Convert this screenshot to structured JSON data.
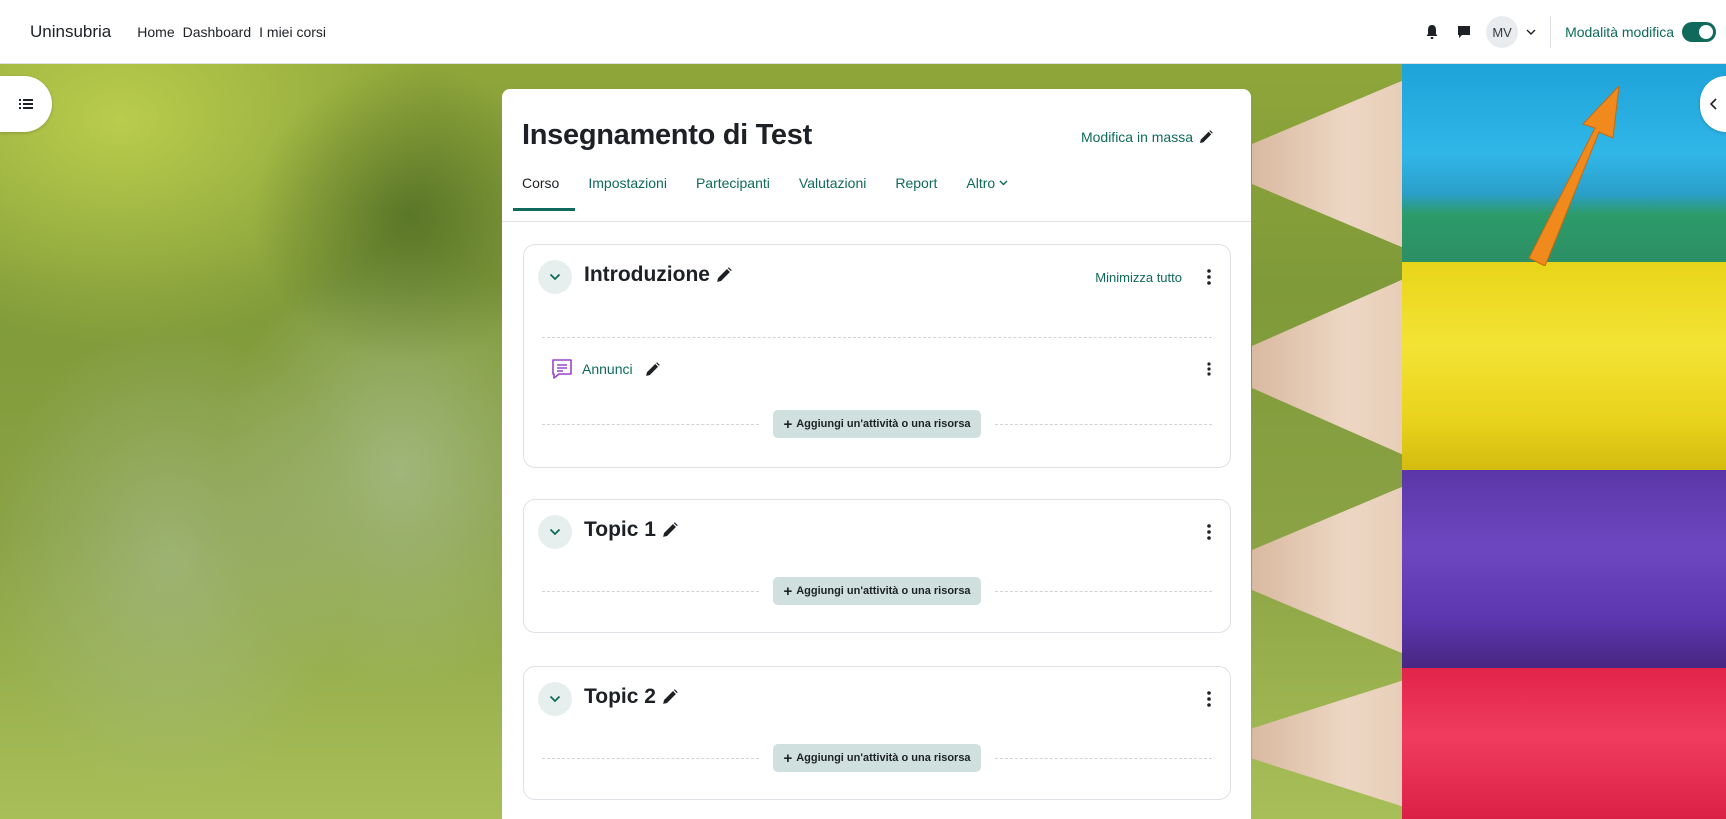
{
  "navbar": {
    "brand": "Uninsubria",
    "links": [
      "Home",
      "Dashboard",
      "I miei corsi"
    ],
    "avatar_initials": "MV",
    "edit_mode_label": "Modalità modifica",
    "edit_mode_on": true,
    "icons": [
      "bell-icon",
      "chat-icon",
      "chevron-down-icon"
    ]
  },
  "course": {
    "title": "Insegnamento di Test",
    "bulk_edit_label": "Modifica in massa",
    "tabs": [
      {
        "label": "Corso",
        "active": true
      },
      {
        "label": "Impostazioni",
        "active": false
      },
      {
        "label": "Partecipanti",
        "active": false
      },
      {
        "label": "Valutazioni",
        "active": false
      },
      {
        "label": "Report",
        "active": false
      },
      {
        "label": "Altro",
        "active": false
      }
    ]
  },
  "sections": [
    {
      "title": "Introduzione",
      "collapse_all_label": "Minimizza tutto",
      "activities": [
        {
          "name": "Annunci",
          "icon": "forum-icon"
        }
      ],
      "add_label": "Aggiungi un'attività o una risorsa"
    },
    {
      "title": "Topic 1",
      "activities": [],
      "add_label": "Aggiungi un'attività o una risorsa"
    },
    {
      "title": "Topic 2",
      "activities": [],
      "add_label": "Aggiungi un'attività o una risorsa"
    }
  ],
  "colors": {
    "primary": "#0f6a5b",
    "add_button_bg": "#cfe0de",
    "annotation_arrow": "#f08a1c"
  }
}
